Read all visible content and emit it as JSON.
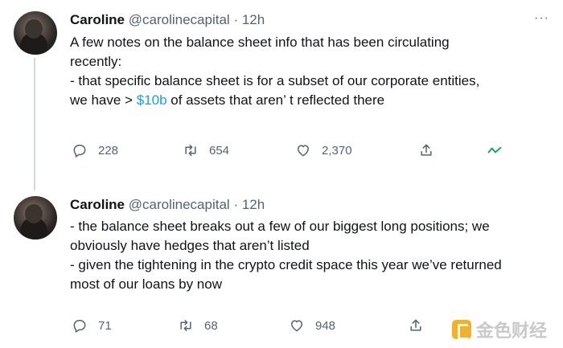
{
  "tweets": [
    {
      "name": "Caroline",
      "handle": "@carolinecapital",
      "dot": "·",
      "time": "12h",
      "more": "···",
      "lines": [
        "A few notes on the balance sheet info that has been circulating",
        "recently:",
        "- that specific balance sheet is for a subset of our corporate entities,"
      ],
      "last_line_prefix": "we have > ",
      "last_line_link": "$10b",
      "last_line_suffix": " of assets that aren’  t reflected there",
      "replies": "228",
      "retweets": "654",
      "likes": "2,370",
      "icons": [
        "reply-icon",
        "retweet-icon",
        "like-icon",
        "share-icon",
        "analytics-icon"
      ]
    },
    {
      "name": "Caroline",
      "handle": "@carolinecapital",
      "dot": "·",
      "time": "12h",
      "lines": [
        "- the balance sheet breaks out a few of our biggest long positions; we",
        "obviously have hedges that aren’t listed",
        "- given the tightening in the crypto credit space this year we’ve returned",
        "most of our loans by now"
      ],
      "replies": "71",
      "retweets": "68",
      "likes": "948",
      "icons": [
        "reply-icon",
        "retweet-icon",
        "like-icon",
        "share-icon"
      ]
    }
  ],
  "watermark": {
    "text": "金色财经"
  },
  "colors": {
    "link": "#1d9bf0",
    "muted": "#536471",
    "analytics": "#17a34a"
  }
}
